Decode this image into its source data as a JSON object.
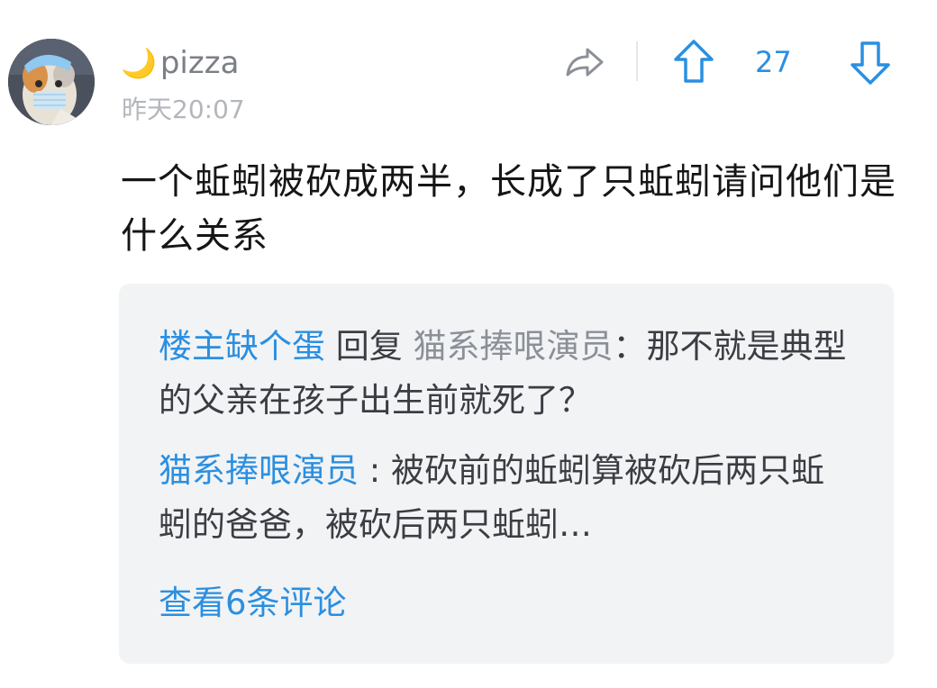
{
  "comment": {
    "user": {
      "name": "pizza",
      "name_prefix_emoji": "🌙"
    },
    "timestamp": "昨天20:07",
    "votes": 27,
    "text": "一个蚯蚓被砍成两半，长成了只蚯蚓请问他们是什么关系"
  },
  "replies": [
    {
      "author": "楼主缺个蛋",
      "reply_word": " 回复 ",
      "target": "猫系捧哏演员",
      "separator": "：",
      "text": "那不就是典型的父亲在孩子出生前就死了？"
    },
    {
      "author": "猫系捧哏演员",
      "separator": " : ",
      "text": "被砍前的蚯蚓算被砍后两只蚯蚓的爸爸，被砍后两只蚯蚓…"
    }
  ],
  "view_more_label": "查看6条评论",
  "colors": {
    "accent": "#2b8fe0",
    "reply_bg": "#f2f3f5",
    "muted_text": "#b3b6bb"
  },
  "icons": {
    "share": "share-arrow-icon",
    "upvote": "arrow-up-icon",
    "downvote": "arrow-down-icon"
  }
}
